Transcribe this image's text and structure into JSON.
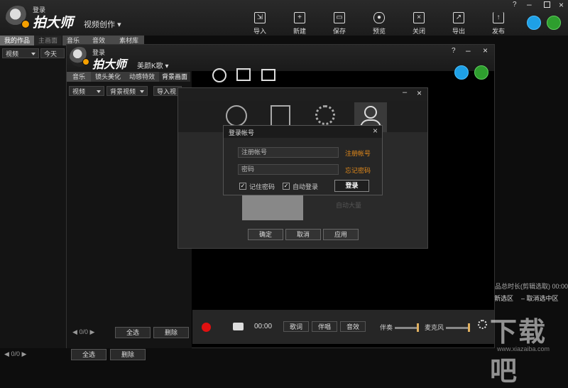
{
  "main_window": {
    "login_label": "登录",
    "brand": "拍大师",
    "mode": "视频创作",
    "toolbar": [
      {
        "label": "导入",
        "icon": "import-icon"
      },
      {
        "label": "新建",
        "icon": "new-icon"
      },
      {
        "label": "保存",
        "icon": "save-icon"
      },
      {
        "label": "预览",
        "icon": "preview-icon"
      },
      {
        "label": "关闭",
        "icon": "close-file-icon"
      },
      {
        "label": "导出",
        "icon": "export-icon"
      },
      {
        "label": "发布",
        "icon": "publish-icon"
      }
    ],
    "help": "?",
    "left_tabs": [
      "我的作品",
      "主画面"
    ],
    "right_tabs": [
      "音乐",
      "音效",
      "素材库"
    ],
    "video_select": "视频",
    "today": "今天",
    "page_counter": "0/0",
    "select_all": "全选",
    "delete": "删除",
    "total_length": "品总时长(剪辑选取) 00:00",
    "new_selection": "新选区",
    "cancel_selection": "取消选中区"
  },
  "child_window": {
    "login_label": "登录",
    "brand": "拍大师",
    "mode": "美颜K歌",
    "help": "?",
    "tabs": [
      "音乐",
      "镜头美化",
      "动感特效",
      "背景画面"
    ],
    "video_select": "视频",
    "bg_select": "背景视频",
    "import": "导入视",
    "page_counter": "0/0",
    "select_all": "全选",
    "delete": "删除",
    "time": "00:00",
    "buttons": [
      "歌词",
      "伴唱",
      "音效"
    ],
    "accompany": "伴奏",
    "mic": "麦克风"
  },
  "login_dialog": {
    "title": "登录帐号",
    "account_placeholder": "注册帐号",
    "register_link": "注册帐号",
    "password_placeholder": "密码",
    "forgot_link": "忘记密码",
    "remember": "记住密码",
    "auto_login": "自动登录",
    "login_button": "登录",
    "behind_text": "自动大量"
  },
  "outer_dialog": {
    "confirm": "确定",
    "cancel": "取消",
    "apply": "应用"
  },
  "watermark": {
    "text": "下载吧",
    "url": "www.xiazaiba.com"
  }
}
